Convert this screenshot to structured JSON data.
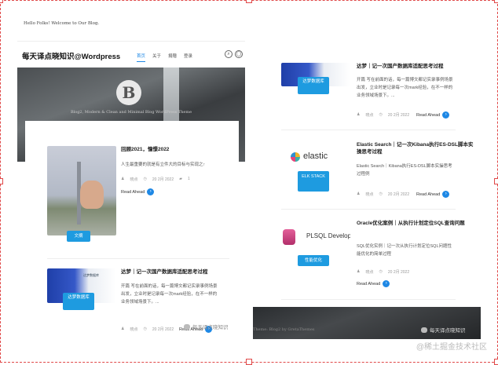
{
  "left": {
    "hello": "Hello Folks! Welcome to Our Blog.",
    "site_title": "每天译点晓知识@Wordpress",
    "nav": [
      "首页",
      "关于",
      "捐赠",
      "登录"
    ],
    "hero_logo": "B",
    "hero_tagline": "Blog2, Modern & Clean and Minimal Blog WordPress Theme",
    "posts": [
      {
        "title": "回顾2021，憧憬2022",
        "excerpt": "人生最重要的就是有立件大的目标与实现之↑",
        "author": "晓点",
        "date": "20 2月 2022",
        "comments": "1",
        "read": "Read Ahead",
        "category": "文摘"
      },
      {
        "title": "达梦｜记一次国产数据库适配思考过程",
        "excerpt": "开篇 写在前面的话，每一篇博文都记实录事例场景出发，立业时是记录每一次mark经验，在不一样的业务领域场景下。...",
        "author": "晓点",
        "date": "20 2月 2022",
        "read": "Read Ahead",
        "category": "达梦数据库",
        "image_label": "达梦数据库"
      }
    ],
    "watermark": "每天译点晓知识"
  },
  "right": {
    "posts": [
      {
        "title": "达梦｜记一次国产数据库适配思考过程",
        "excerpt": "开篇 写在前面的话，每一篇博文都记实录事例场景出发，立业时是记录每一次mark经验，在不一样的业务领域场景下。...",
        "author": "晓点",
        "date": "20 2月 2022",
        "read": "Read Ahead",
        "category": "达梦数据库"
      },
      {
        "title": "Elastic Search｜记一次Kibana执行ES-DSL脚本实操思考过程",
        "excerpt": "Elastic Search｜Kibana执行ES-DSL脚本实操思考过程例",
        "author": "晓点",
        "date": "20 2月 2022",
        "read": "Read Ahead",
        "category": "ELK STACK",
        "image_label": "elastic"
      },
      {
        "title": "Oracle优化案例｜从执行计划定位SQL查询问题",
        "excerpt": "SQL优化实例｜记一次从执行计划定位SQL问题性能优化的简单过程",
        "author": "晓点",
        "date": "20 2月 2022",
        "read": "Read Ahead",
        "category": "性能优化",
        "image_label": "PLSQL Develope"
      }
    ],
    "footer_text": "Theme: Blog2 by GretaThemes",
    "watermark": "每天译点晓知识"
  },
  "juejin": "@稀土掘金技术社区",
  "colors": {
    "accent": "#1e88e5",
    "frame": "#e04848"
  }
}
